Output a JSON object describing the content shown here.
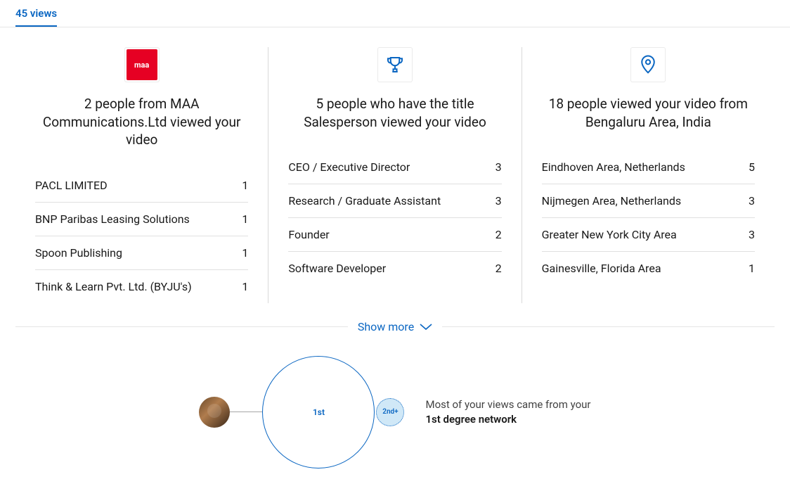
{
  "tab": {
    "label": "45 views"
  },
  "panels": {
    "company": {
      "heading": "2 people from MAA Communications.Ltd viewed your video",
      "items": [
        {
          "label": "PACL LIMITED",
          "value": "1"
        },
        {
          "label": "BNP Paribas Leasing Solutions",
          "value": "1"
        },
        {
          "label": "Spoon Publishing",
          "value": "1"
        },
        {
          "label": "Think & Learn Pvt. Ltd. (BYJU's)",
          "value": "1"
        }
      ]
    },
    "title": {
      "heading": "5 people who have the title Salesperson viewed your video",
      "items": [
        {
          "label": "CEO / Executive Director",
          "value": "3"
        },
        {
          "label": "Research / Graduate Assistant",
          "value": "3"
        },
        {
          "label": "Founder",
          "value": "2"
        },
        {
          "label": "Software Developer",
          "value": "2"
        }
      ]
    },
    "location": {
      "heading": "18 people viewed your video from Bengaluru Area, India",
      "items": [
        {
          "label": "Eindhoven Area, Netherlands",
          "value": "5"
        },
        {
          "label": "Nijmegen Area, Netherlands",
          "value": "3"
        },
        {
          "label": "Greater New York City Area",
          "value": "3"
        },
        {
          "label": "Gainesville, Florida Area",
          "value": "1"
        }
      ]
    }
  },
  "show_more": "Show more",
  "network": {
    "circle1": "1st",
    "circle2": "2nd+",
    "text_prefix": "Most of your views came from your",
    "text_bold": "1st degree network"
  },
  "icons": {
    "company_glyph": "maa",
    "trophy_color": "#0A66C2",
    "pin_color": "#0A66C2"
  }
}
